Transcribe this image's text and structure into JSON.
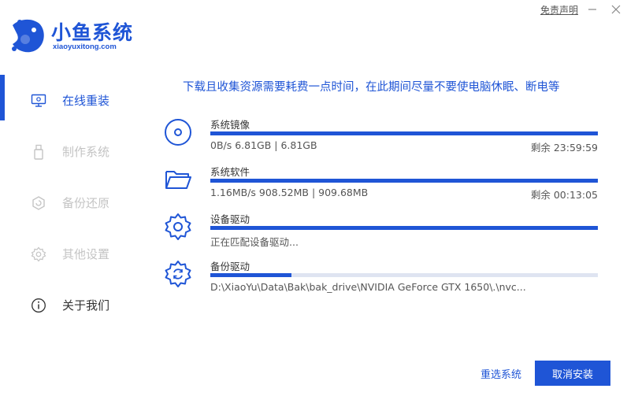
{
  "window": {
    "disclaimer": "免责声明"
  },
  "logo": {
    "title": "小鱼系统",
    "subtitle": "xiaoyuxitong.com"
  },
  "sidebar": {
    "items": [
      {
        "label": "在线重装",
        "icon": "monitor-icon",
        "state": "active"
      },
      {
        "label": "制作系统",
        "icon": "usb-drive-icon",
        "state": "disabled"
      },
      {
        "label": "备份还原",
        "icon": "backup-restore-icon",
        "state": "disabled"
      },
      {
        "label": "其他设置",
        "icon": "gear-icon",
        "state": "disabled"
      },
      {
        "label": "关于我们",
        "icon": "info-icon",
        "state": "normal"
      }
    ]
  },
  "main": {
    "notice": "下载且收集资源需要耗费一点时间，在此期间尽量不要使电脑休眠、断电等",
    "tasks": [
      {
        "name": "系统镜像",
        "icon": "disc-icon",
        "detail": "0B/s 6.81GB | 6.81GB",
        "remaining": "剩余 23:59:59",
        "progress": 1.0
      },
      {
        "name": "系统软件",
        "icon": "folder-icon",
        "detail": "1.16MB/s 908.52MB | 909.68MB",
        "remaining": "剩余 00:13:05",
        "progress": 1.0
      },
      {
        "name": "设备驱动",
        "icon": "gear-icon",
        "detail": "正在匹配设备驱动...",
        "remaining": "",
        "progress": 1.0
      },
      {
        "name": "备份驱动",
        "icon": "gear-refresh-icon",
        "detail": "D:\\XiaoYu\\Data\\Bak\\bak_drive\\NVIDIA GeForce GTX 1650\\.\\nvc...",
        "remaining": "",
        "progress": 0.21
      }
    ]
  },
  "buttons": {
    "reselect": "重选系统",
    "cancel": "取消安装"
  },
  "colors": {
    "accent": "#1f55d6",
    "track": "#dfe4f1"
  }
}
